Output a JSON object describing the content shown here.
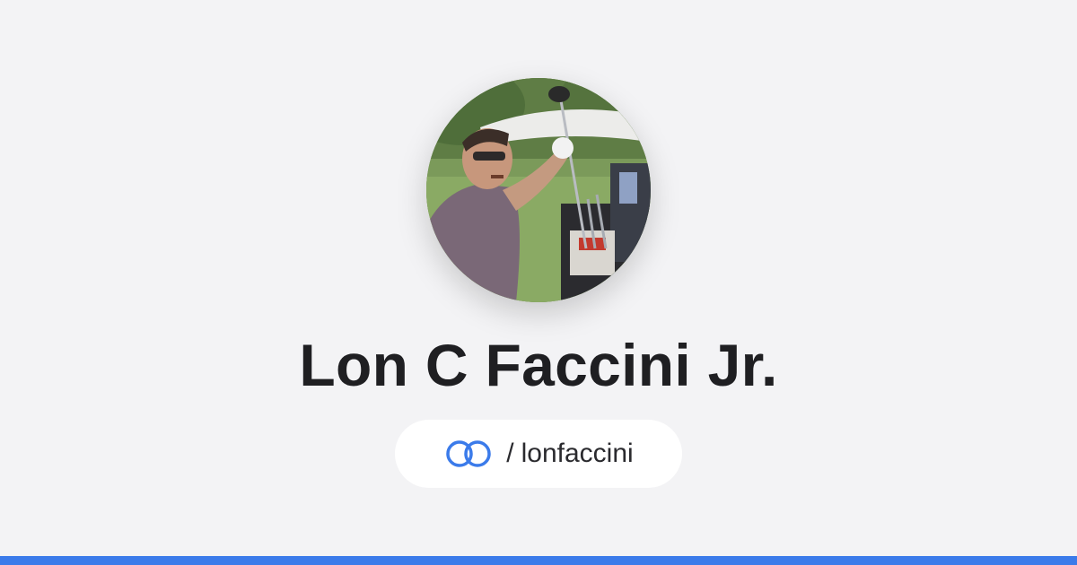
{
  "profile": {
    "name": "Lon C Faccini Jr.",
    "handle_prefix": "/",
    "handle": "lonfaccini",
    "avatar_alt": "profile photo"
  },
  "icons": {
    "link": "link-rings-icon"
  },
  "colors": {
    "background": "#f3f3f5",
    "accent": "#3b7bea",
    "text": "#1f1f22",
    "pill": "#ffffff"
  }
}
